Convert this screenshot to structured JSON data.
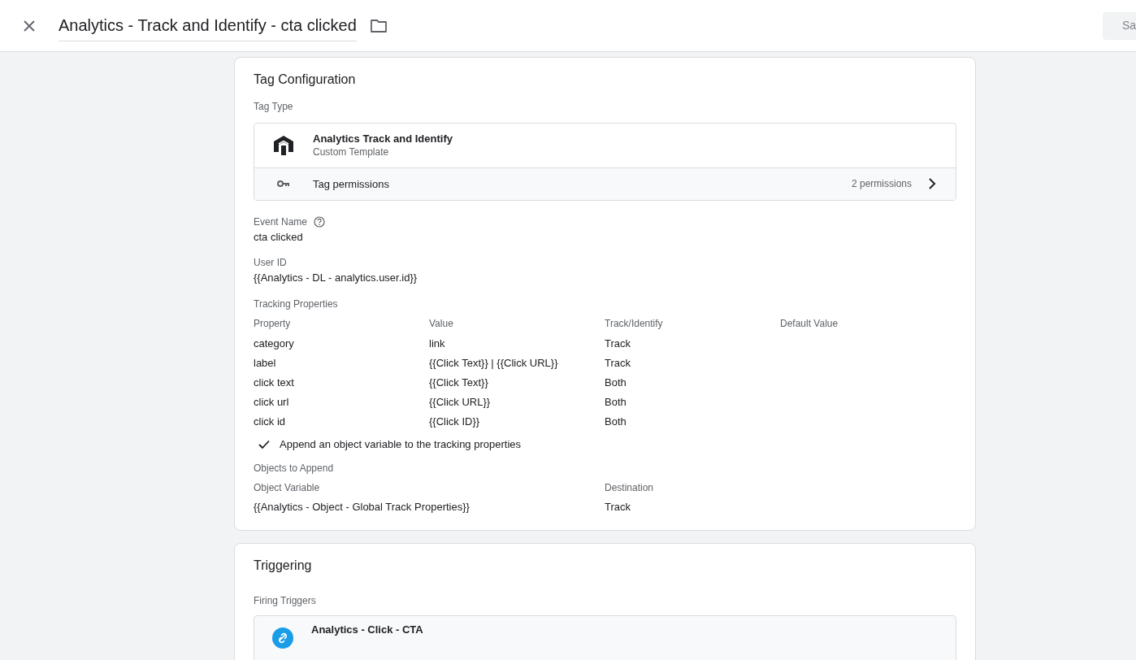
{
  "header": {
    "title": "Analytics - Track and Identify - cta clicked",
    "save_button": "Sa"
  },
  "tag_configuration": {
    "title": "Tag Configuration",
    "tag_type_label": "Tag Type",
    "tag_type": {
      "name": "Analytics Track and Identify",
      "subtitle": "Custom Template"
    },
    "permissions": {
      "label": "Tag permissions",
      "count": "2 permissions"
    },
    "fields": [
      {
        "label": "Event Name",
        "help": true,
        "value": "cta clicked"
      },
      {
        "label": "User ID",
        "help": false,
        "value": "{{Analytics - DL - analytics.user.id}}"
      }
    ],
    "tracking_properties": {
      "label": "Tracking Properties",
      "columns": [
        "Property",
        "Value",
        "Track/Identify",
        "Default Value"
      ],
      "rows": [
        [
          "category",
          "link",
          "Track",
          ""
        ],
        [
          "label",
          "{{Click Text}} | {{Click URL}}",
          "Track",
          ""
        ],
        [
          "click text",
          "{{Click Text}}",
          "Both",
          ""
        ],
        [
          "click url",
          "{{Click URL}}",
          "Both",
          ""
        ],
        [
          "click id",
          "{{Click ID}}",
          "Both",
          ""
        ]
      ]
    },
    "append_option": {
      "label": "Append an object variable to the tracking properties",
      "checked": true
    },
    "objects_to_append": {
      "label": "Objects to Append",
      "columns": [
        "Object Variable",
        "Destination"
      ],
      "rows": [
        [
          "{{Analytics - Object - Global Track Properties}}",
          "Track"
        ]
      ]
    }
  },
  "triggering": {
    "title": "Triggering",
    "firing_label": "Firing Triggers",
    "triggers": [
      {
        "name": "Analytics - Click - CTA"
      }
    ]
  }
}
